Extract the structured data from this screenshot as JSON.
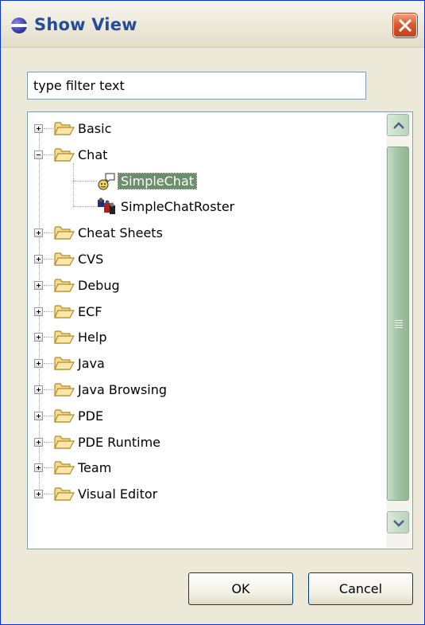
{
  "window": {
    "title": "Show View"
  },
  "filter": {
    "placeholder": "type filter text",
    "value": "type filter text"
  },
  "tree": {
    "folders": [
      {
        "label": "Basic",
        "expanded": false
      },
      {
        "label": "Chat",
        "expanded": true,
        "children": [
          {
            "label": "SimpleChat",
            "icon": "chat-view-icon",
            "selected": true
          },
          {
            "label": "SimpleChatRoster",
            "icon": "roster-view-icon",
            "selected": false
          }
        ]
      },
      {
        "label": "Cheat Sheets",
        "expanded": false
      },
      {
        "label": "CVS",
        "expanded": false
      },
      {
        "label": "Debug",
        "expanded": false
      },
      {
        "label": "ECF",
        "expanded": false
      },
      {
        "label": "Help",
        "expanded": false
      },
      {
        "label": "Java",
        "expanded": false
      },
      {
        "label": "Java Browsing",
        "expanded": false
      },
      {
        "label": "PDE",
        "expanded": false
      },
      {
        "label": "PDE Runtime",
        "expanded": false
      },
      {
        "label": "Team",
        "expanded": false
      },
      {
        "label": "Visual Editor",
        "expanded": false
      }
    ]
  },
  "buttons": {
    "ok": "OK",
    "cancel": "Cancel"
  },
  "colors": {
    "selection": "#6b8f6b",
    "scrollbar": "#9fbf9f",
    "close": "#d85a2c",
    "title": "#244c9a"
  },
  "icons": {
    "app": "eclipse-icon",
    "close": "close-icon",
    "folder": "folder-icon",
    "scroll_up": "chevron-up-icon",
    "scroll_down": "chevron-down-icon"
  }
}
